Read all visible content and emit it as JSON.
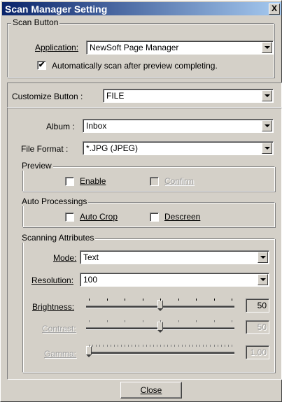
{
  "window": {
    "title": "Scan Manager Setting",
    "close_label": "X"
  },
  "scan_button": {
    "group_label": "Scan Button",
    "application_label": "Application:",
    "application_value": "NewSoft Page Manager",
    "auto_scan_checked": "✔",
    "auto_scan_label": "Automatically scan after preview completing."
  },
  "customize": {
    "label": "Customize Button :",
    "value": "FILE"
  },
  "album": {
    "label": "Album :",
    "value": "Inbox"
  },
  "file_format": {
    "label": "File Format :",
    "value": "*.JPG (JPEG)"
  },
  "preview": {
    "group_label": "Preview",
    "enable_label": "Enable",
    "enable_checked": false,
    "confirm_label": "Confirm",
    "confirm_enabled": false
  },
  "auto_processings": {
    "group_label": "Auto Processings",
    "auto_crop_label": "Auto Crop",
    "auto_crop_checked": false,
    "descreen_label": "Descreen",
    "descreen_checked": false
  },
  "scanning_attributes": {
    "group_label": "Scanning Attributes",
    "mode_label": "Mode:",
    "mode_value": "Text",
    "resolution_label": "Resolution:",
    "resolution_value": "100",
    "brightness_label": "Brightness:",
    "brightness_value": "50",
    "brightness_fraction": 0.5,
    "contrast_label": "Contrast:",
    "contrast_value": "50",
    "contrast_fraction": 0.5,
    "contrast_enabled": false,
    "gamma_label": "Gamma:",
    "gamma_value": "1.00",
    "gamma_fraction": 0.0,
    "gamma_enabled": false
  },
  "footer": {
    "close_label": "Close"
  }
}
